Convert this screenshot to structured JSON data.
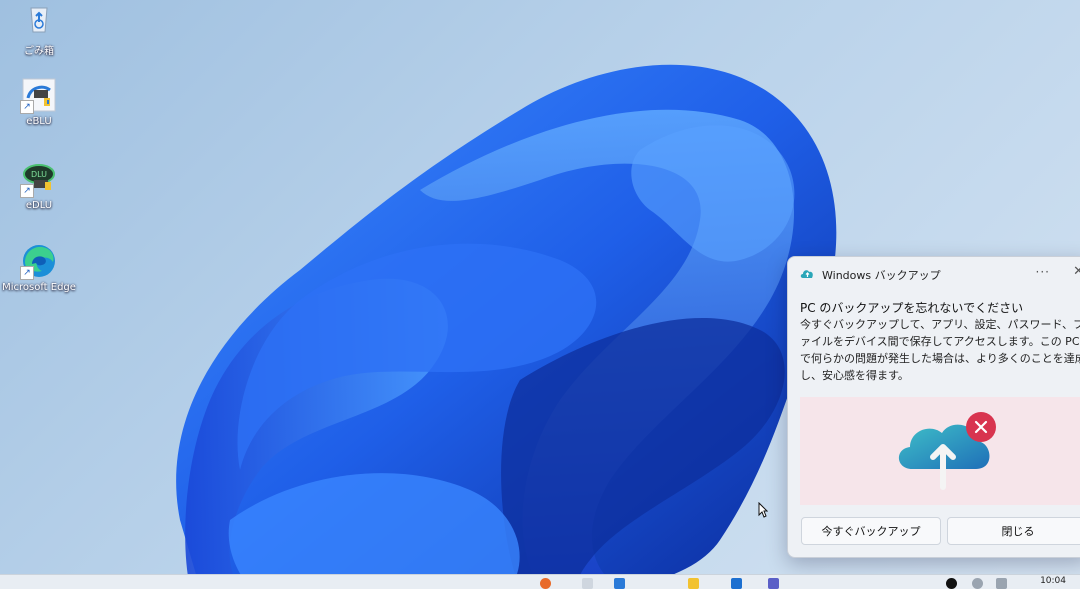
{
  "desktop": {
    "icons": [
      {
        "label": "ごみ箱",
        "icon": "recycle-bin-icon"
      },
      {
        "label": "eBLU",
        "icon": "ebl-app-icon"
      },
      {
        "label": "eDLU",
        "icon": "edlu-app-icon"
      },
      {
        "label": "Microsoft Edge",
        "icon": "edge-icon"
      }
    ]
  },
  "toast": {
    "app_name": "Windows バックアップ",
    "more_label": "···",
    "close_label": "✕",
    "title": "PC のバックアップを忘れないでください",
    "body": "今すぐバックアップして、アプリ、設定、パスワード、ファイルをデバイス間で保存してアクセスします。この PC で何らかの問題が発生した場合は、より多くのことを達成し、安心感を得ます。",
    "hero_icon": "cloud-upload-error-icon",
    "primary_button": "今すぐバックアップ",
    "secondary_button": "閉じる"
  },
  "taskbar": {
    "clock": "10:04"
  },
  "colors": {
    "wallpaper_blue": "#1f5fe8",
    "error_red": "#d8344f",
    "cloud_teal": "#2aa6b8"
  }
}
